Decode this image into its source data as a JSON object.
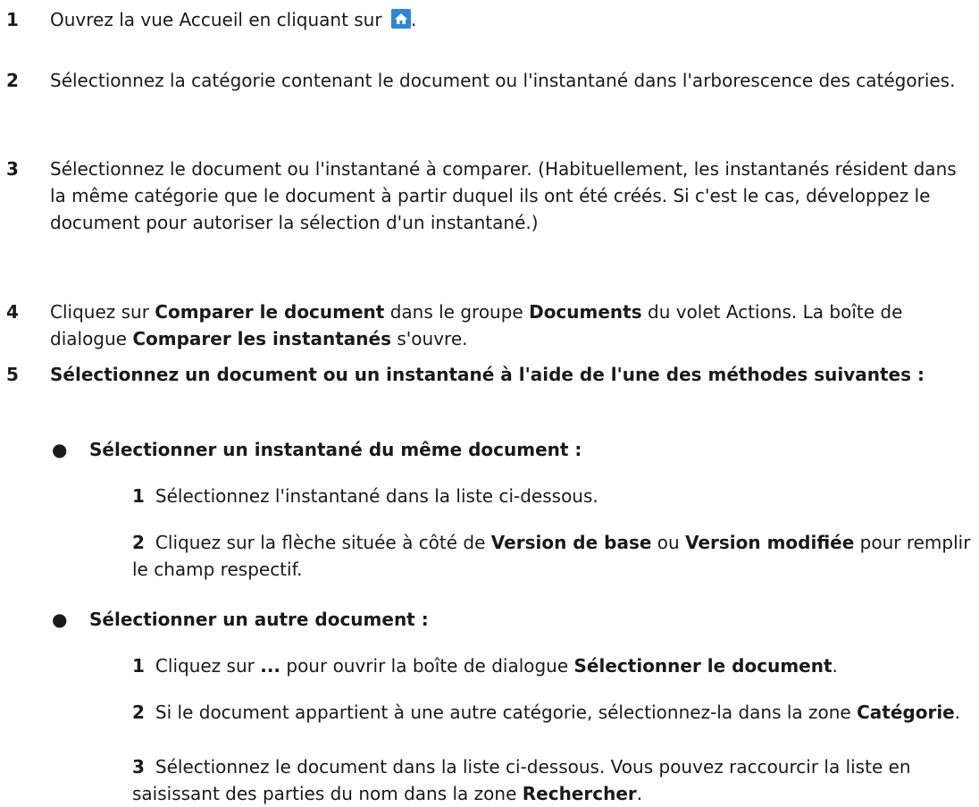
{
  "steps": [
    {
      "num": "1",
      "text_before": "Ouvrez la vue Accueil en cliquant sur",
      "text_after": ".",
      "icon": "home-icon"
    },
    {
      "num": "2",
      "text": "Sélectionnez la catégorie contenant le document ou l'instantané dans l'arborescence des catégories."
    },
    {
      "num": "3",
      "text": "Sélectionnez le document ou l'instantané à comparer. (Habituellement, les instantanés résident dans la même catégorie que le document à partir duquel ils ont été créés. Si c'est le cas, développez le document pour autoriser la sélection d'un instantané.)"
    },
    {
      "num": "4",
      "p1": "Cliquez sur",
      "b1": "Comparer le document",
      "p2": "dans le groupe",
      "b2": "Documents",
      "p3": "du volet Actions. La boîte de dialogue",
      "b3": "Comparer les instantanés",
      "p4": "s'ouvre."
    },
    {
      "num": "5",
      "text": "Sélectionnez un document ou un instantané à l'aide de l'une des méthodes suivantes :"
    }
  ],
  "options": [
    {
      "bullet": "●",
      "title": "Sélectionner un instantané du même document :",
      "substeps": [
        {
          "num": "1",
          "text": "Sélectionnez l'instantané dans la liste ci-dessous."
        },
        {
          "num": "2",
          "p1": "Cliquez sur la flèche située à côté de",
          "b1": "Version de base",
          "p2": "ou",
          "b2": "Version modifiée",
          "p3": "pour remplir le champ respectif."
        }
      ]
    },
    {
      "bullet": "●",
      "title": "Sélectionner un autre document :",
      "substeps": [
        {
          "num": "1",
          "p1": "Cliquez sur",
          "b1": "...",
          "p2": "pour ouvrir la boîte de dialogue",
          "b2": "Sélectionner le document",
          "p3": "."
        },
        {
          "num": "2",
          "p1": "Si le document appartient à une autre catégorie, sélectionnez-la dans la zone",
          "b1": "Catégorie",
          "p2": "."
        },
        {
          "num": "3",
          "p1": "Sélectionnez le document dans la liste ci-dessous. Vous pouvez raccourcir la liste en saisissant des parties du nom dans la zone",
          "b1": "Rechercher",
          "p2": "."
        }
      ]
    }
  ]
}
